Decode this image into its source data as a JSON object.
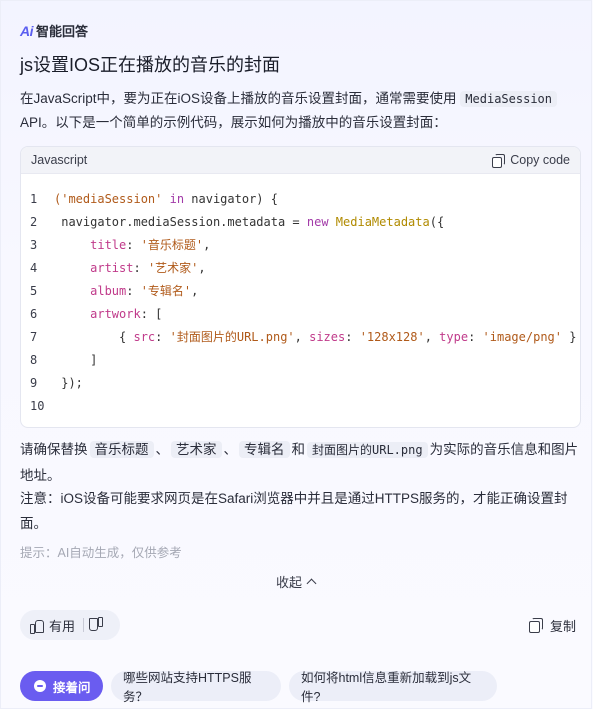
{
  "brand": {
    "logo": "Ai",
    "name": "智能回答"
  },
  "title": "js设置IOS正在播放的音乐的封面",
  "intro": {
    "text1": "在JavaScript中，要为正在iOS设备上播放的音乐设置封面，通常需要使用",
    "code": "MediaSession",
    "text2": "API。以下是一个简单的示例代码，展示如何为播放中的音乐设置封面："
  },
  "code_block": {
    "language": "Javascript",
    "copy_label": "Copy code",
    "line_numbers": [
      "1",
      "2",
      "3",
      "4",
      "5",
      "6",
      "7",
      "8",
      "9",
      "10"
    ]
  },
  "para1": {
    "t1": "请确保替换",
    "tag1": "音乐标题",
    "sep1": "、",
    "tag2": "艺术家",
    "sep2": "、",
    "tag3": "专辑名",
    "and": "和",
    "tag4": "封面图片的URL.png",
    "t2": "为实际的音乐信息和图片地址。"
  },
  "para2": "注意：iOS设备可能要求网页是在Safari浏览器中并且是通过HTTPS服务的，才能正确设置封面。",
  "hint": "提示：AI自动生成，仅供参考",
  "collapse_label": "收起",
  "feedback": {
    "useful": "有用"
  },
  "copy_label": "复制",
  "followups": {
    "main": "接着问",
    "q1": "哪些网站支持HTTPS服务？",
    "q2": "如何将html信息重新加载到js文件?"
  }
}
